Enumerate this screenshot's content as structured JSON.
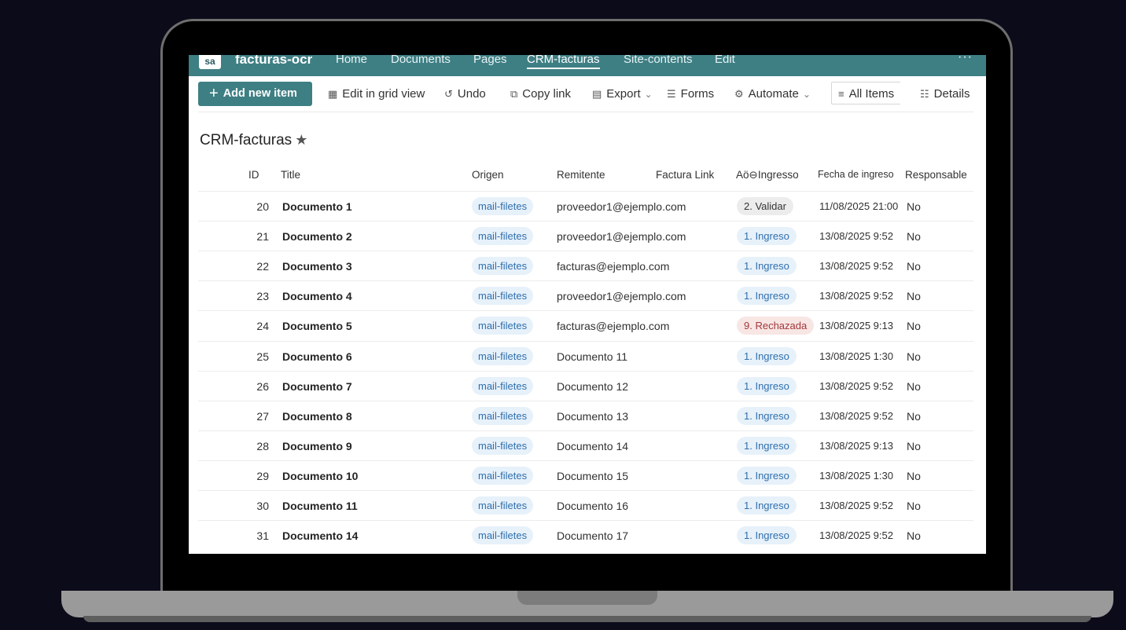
{
  "site": {
    "logo_text": "sa",
    "name": "facturas-ocr",
    "nav": [
      "Home",
      "Documents",
      "Pages",
      "CRM-facturas",
      "Site-contents",
      "Edit"
    ],
    "active_nav": "CRM-facturas",
    "more": "···"
  },
  "commands": {
    "add_new": "Add new item",
    "grid_view": "Edit in grid view",
    "undo": "Undo",
    "copy_link": "Copy link",
    "export": "Export",
    "forms": "Forms",
    "automate": "Automate",
    "all_items": "All Items",
    "details": "Details"
  },
  "list": {
    "title": "CRM-facturas",
    "star": "★",
    "columns": {
      "id": "ID",
      "title": "Title",
      "origen": "Origen",
      "remitente": "Remitente",
      "factura_link": "Factura Link",
      "estado": "Aö⊖Ingresso",
      "fecha": "Fecha de ingreso",
      "responsable": "Responsable"
    },
    "rows": [
      {
        "id": "20",
        "title": "Documento 1",
        "origen": "mail-filetes",
        "remitente": "proveedor1@ejemplo.com",
        "estado": "2. Validar",
        "estado_kind": "validar",
        "fecha": "11/08/2025 21:00",
        "responsable": "No"
      },
      {
        "id": "21",
        "title": "Documento 2",
        "origen": "mail-filetes",
        "remitente": "proveedor1@ejemplo.com",
        "estado": "1. Ingreso",
        "estado_kind": "ingreso",
        "fecha": "13/08/2025 9:52",
        "responsable": "No"
      },
      {
        "id": "22",
        "title": "Documento 3",
        "origen": "mail-filetes",
        "remitente": "facturas@ejemplo.com",
        "estado": "1. Ingreso",
        "estado_kind": "ingreso",
        "fecha": "13/08/2025 9:52",
        "responsable": "No"
      },
      {
        "id": "23",
        "title": "Documento 4",
        "origen": "mail-filetes",
        "remitente": "proveedor1@ejemplo.com",
        "estado": "1. Ingreso",
        "estado_kind": "ingreso",
        "fecha": "13/08/2025 9:52",
        "responsable": "No"
      },
      {
        "id": "24",
        "title": "Documento 5",
        "origen": "mail-filetes",
        "remitente": "facturas@ejemplo.com",
        "estado": "9. Rechazada",
        "estado_kind": "rechazada",
        "fecha": "13/08/2025 9:13",
        "responsable": "No"
      },
      {
        "id": "25",
        "title": "Documento 6",
        "origen": "mail-filetes",
        "remitente": "Documento 11",
        "estado": "1. Ingreso",
        "estado_kind": "ingreso",
        "fecha": "13/08/2025 1:30",
        "responsable": "No"
      },
      {
        "id": "26",
        "title": "Documento 7",
        "origen": "mail-filetes",
        "remitente": "Documento 12",
        "estado": "1. Ingreso",
        "estado_kind": "ingreso",
        "fecha": "13/08/2025 9:52",
        "responsable": "No"
      },
      {
        "id": "27",
        "title": "Documento 8",
        "origen": "mail-filetes",
        "remitente": "Documento 13",
        "estado": "1. Ingreso",
        "estado_kind": "ingreso",
        "fecha": "13/08/2025 9:52",
        "responsable": "No"
      },
      {
        "id": "28",
        "title": "Documento 9",
        "origen": "mail-filetes",
        "remitente": "Documento 14",
        "estado": "1. Ingreso",
        "estado_kind": "ingreso",
        "fecha": "13/08/2025 9:13",
        "responsable": "No"
      },
      {
        "id": "29",
        "title": "Documento 10",
        "origen": "mail-filetes",
        "remitente": "Documento 15",
        "estado": "1. Ingreso",
        "estado_kind": "ingreso",
        "fecha": "13/08/2025 1:30",
        "responsable": "No"
      },
      {
        "id": "30",
        "title": "Documento 11",
        "origen": "mail-filetes",
        "remitente": "Documento 16",
        "estado": "1. Ingreso",
        "estado_kind": "ingreso",
        "fecha": "13/08/2025 9:52",
        "responsable": "No"
      },
      {
        "id": "31",
        "title": "Documento 14",
        "origen": "mail-filetes",
        "remitente": "Documento 17",
        "estado": "1. Ingreso",
        "estado_kind": "ingreso",
        "fecha": "13/08/2025 9:52",
        "responsable": "No"
      }
    ]
  },
  "colors": {
    "brand": "#3e7f84",
    "pill_blue_bg": "#e7f1fa",
    "pill_blue_text": "#2f6fad",
    "rechazada_bg": "#f7e6e4",
    "rechazada_text": "#a4373a"
  }
}
